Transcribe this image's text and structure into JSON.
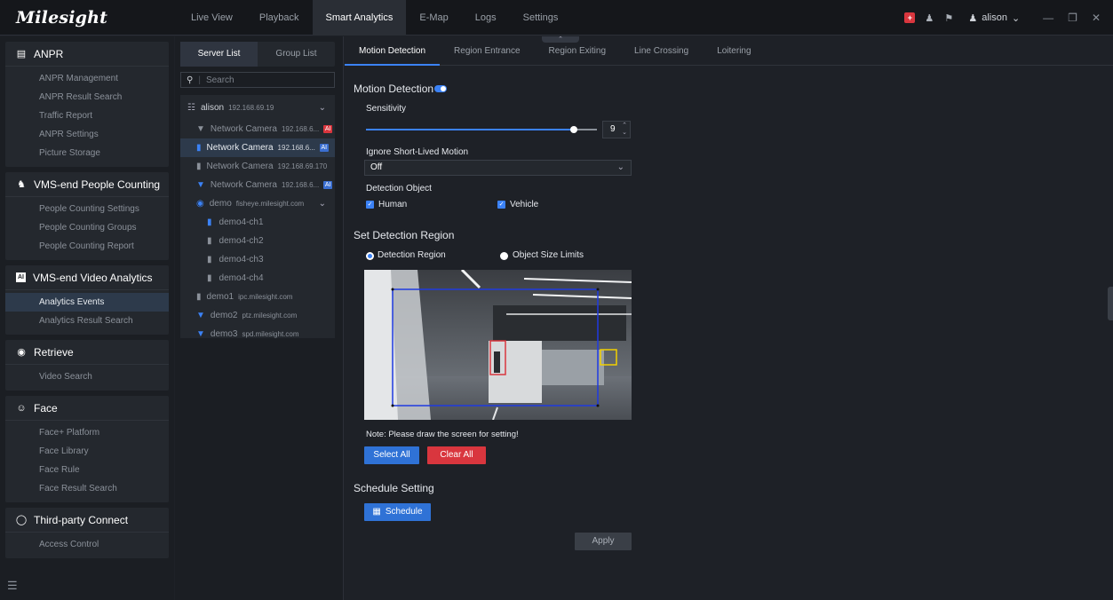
{
  "app": {
    "logo": "Milesight"
  },
  "nav": {
    "tabs": [
      "Live View",
      "Playback",
      "Smart Analytics",
      "E-Map",
      "Logs",
      "Settings"
    ],
    "active": "Smart Analytics"
  },
  "topright": {
    "user": "alison"
  },
  "sidebar": {
    "anpr": {
      "title": "ANPR",
      "items": [
        "ANPR Management",
        "ANPR Result Search",
        "Traffic Report",
        "ANPR Settings",
        "Picture Storage"
      ]
    },
    "people": {
      "title": "VMS-end People Counting",
      "items": [
        "People Counting Settings",
        "People Counting Groups",
        "People Counting Report"
      ]
    },
    "video": {
      "title": "VMS-end Video Analytics",
      "items": [
        "Analytics Events",
        "Analytics Result Search"
      ]
    },
    "retrieve": {
      "title": "Retrieve",
      "items": [
        "Video Search"
      ]
    },
    "face": {
      "title": "Face",
      "items": [
        "Face+ Platform",
        "Face Library",
        "Face Rule",
        "Face Result Search"
      ]
    },
    "third": {
      "title": "Third-party Connect",
      "items": [
        "Access Control"
      ]
    }
  },
  "serverpanel": {
    "tab_server": "Server List",
    "tab_group": "Group List",
    "search_placeholder": "Search",
    "tree": [
      {
        "name": "alison",
        "ip": "192.168.69.19"
      },
      {
        "name": "Network Camera",
        "ip": "192.168.6..."
      },
      {
        "name": "Network Camera",
        "ip": "192.168.6..."
      },
      {
        "name": "Network Camera",
        "ip": "192.168.69.170"
      },
      {
        "name": "Network Camera",
        "ip": "192.168.6..."
      },
      {
        "name": "demo",
        "ip": "fisheye.milesight.com"
      },
      {
        "name": "demo4-ch1",
        "ip": ""
      },
      {
        "name": "demo4-ch2",
        "ip": ""
      },
      {
        "name": "demo4-ch3",
        "ip": ""
      },
      {
        "name": "demo4-ch4",
        "ip": ""
      },
      {
        "name": "demo1",
        "ip": "ipc.milesight.com"
      },
      {
        "name": "demo2",
        "ip": "ptz.milesight.com"
      },
      {
        "name": "demo3",
        "ip": "spd.milesight.com"
      }
    ],
    "badge": "AI"
  },
  "subtabs": [
    "Motion Detection",
    "Region Entrance",
    "Region Exiting",
    "Line Crossing",
    "Loitering"
  ],
  "md": {
    "title": "Motion Detection",
    "sensitivity_label": "Sensitivity",
    "sensitivity_value": "9",
    "sensitivity_fraction": 0.9,
    "ignore_label": "Ignore Short-Lived Motion",
    "ignore_value": "Off",
    "detobj_label": "Detection Object",
    "human": "Human",
    "vehicle": "Vehicle",
    "region_title": "Set Detection Region",
    "radio_region": "Detection Region",
    "radio_size": "Object Size Limits",
    "note": "Note: Please draw the screen for setting!",
    "select_all": "Select All",
    "clear_all": "Clear All",
    "schedule_title": "Schedule Setting",
    "schedule_btn": "Schedule",
    "apply": "Apply"
  }
}
